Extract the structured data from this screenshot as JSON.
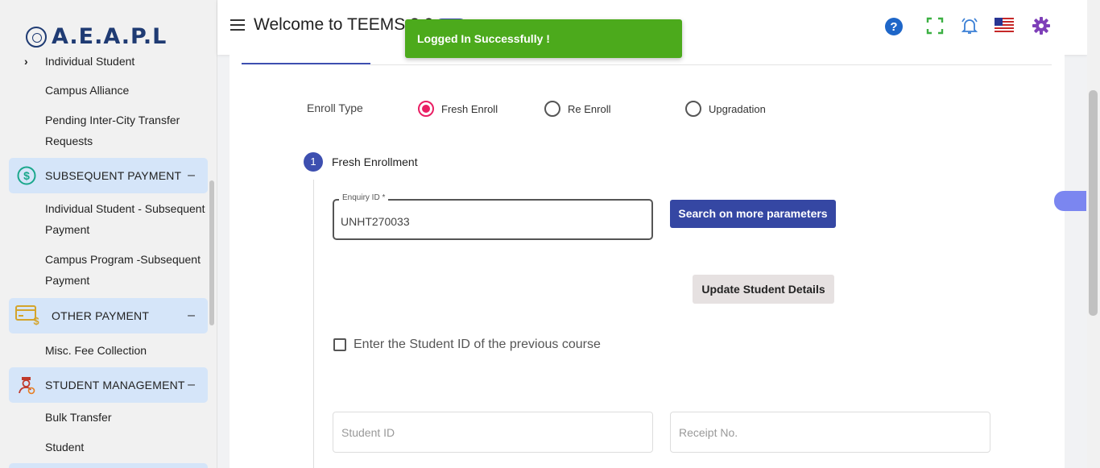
{
  "app": {
    "logo_text": "A.E.A.P.L",
    "title": "Welcome to TEEMS 3.0"
  },
  "toast": {
    "message": "Logged In Successfully !"
  },
  "sidebar": {
    "items": [
      {
        "label": "Individual Student"
      },
      {
        "label": "Campus Alliance"
      },
      {
        "label": "Pending Inter-City Transfer Requests"
      }
    ],
    "sections": [
      {
        "label": "SUBSEQUENT PAYMENT",
        "toggle": "–",
        "children": [
          {
            "label": "Individual Student - Subsequent Payment"
          },
          {
            "label": "Campus Program -Subsequent Payment"
          }
        ]
      },
      {
        "label": "OTHER PAYMENT",
        "toggle": "–",
        "children": [
          {
            "label": "Misc. Fee Collection"
          }
        ]
      },
      {
        "label": "STUDENT MANAGEMENT",
        "toggle": "–",
        "children": [
          {
            "label": "Bulk Transfer"
          },
          {
            "label": "Student"
          }
        ]
      }
    ]
  },
  "header_icons": [
    "help-icon",
    "fullscreen-icon",
    "notification-bell-icon",
    "us-flag-icon",
    "settings-gear-icon"
  ],
  "form": {
    "enroll_type_label": "Enroll Type",
    "enroll_options": [
      {
        "label": "Fresh Enroll",
        "checked": true
      },
      {
        "label": "Re Enroll",
        "checked": false
      },
      {
        "label": "Upgradation",
        "checked": false
      }
    ],
    "step": {
      "number": "1",
      "label": "Fresh Enrollment"
    },
    "enquiry": {
      "label": "Enquiry ID *",
      "value": "UNHT270033"
    },
    "search_button": "Search on more parameters",
    "update_button": "Update Student Details",
    "previous_course_checkbox": {
      "label": "Enter the Student ID of the previous course",
      "checked": false
    },
    "student_id_placeholder": "Student ID",
    "receipt_placeholder": "Receipt No."
  },
  "colors": {
    "primary": "#3547a3",
    "toast_success": "#4caa1c",
    "radio_active": "#e91e63",
    "section_bg": "#d5e5f9"
  }
}
